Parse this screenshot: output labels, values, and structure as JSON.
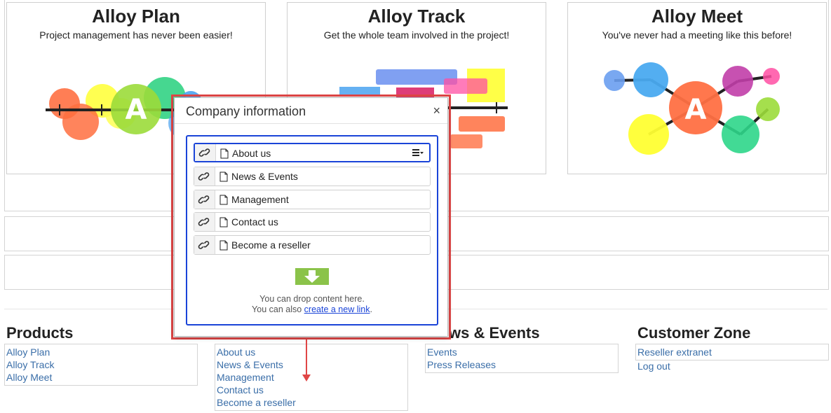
{
  "cards": [
    {
      "title": "Alloy Plan",
      "subtitle": "Project management has never been easier!",
      "logo_letter": "A"
    },
    {
      "title": "Alloy Track",
      "subtitle": "Get the whole team involved in the project!",
      "logo_letter": ""
    },
    {
      "title": "Alloy Meet",
      "subtitle": "You've never had a meeting like this before!",
      "logo_letter": "A"
    }
  ],
  "footer": {
    "columns": [
      {
        "heading": "Products",
        "links": [
          "Alloy Plan",
          "Alloy Track",
          "Alloy Meet"
        ]
      },
      {
        "heading": "",
        "links": [
          "About us",
          "News & Events",
          "Management",
          "Contact us",
          "Become a reseller"
        ]
      },
      {
        "heading": "ws & Events",
        "links": [
          "Events",
          "Press Releases"
        ]
      },
      {
        "heading": "Customer Zone",
        "links": [
          "Reseller extranet",
          "Log out"
        ]
      }
    ]
  },
  "dialog": {
    "title": "Company information",
    "close_glyph": "×",
    "items": [
      "About us",
      "News & Events",
      "Management",
      "Contact us",
      "Become a reseller"
    ],
    "selected_index": 0,
    "drop_text": "You can drop content here.",
    "drop_text_prefix": "You can also ",
    "drop_link": "create a new link",
    "drop_text_suffix": "."
  },
  "colors": {
    "accent": "#1a44d8",
    "highlight": "#e04646",
    "link": "#3a6ea8",
    "drop_arrow": "#8bc34a"
  },
  "icons": [
    "link-icon",
    "document-icon",
    "hamburger-menu-icon",
    "close-icon",
    "drop-arrow-icon"
  ]
}
